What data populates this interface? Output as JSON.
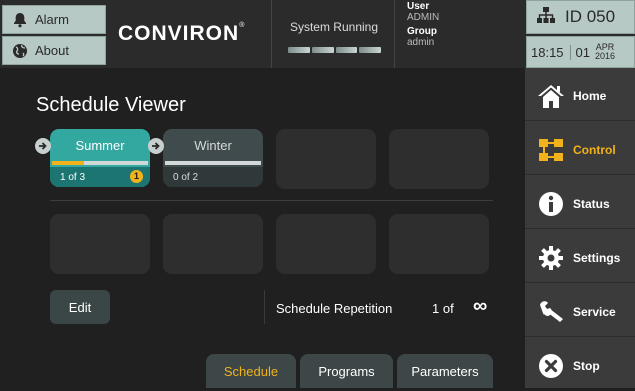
{
  "header": {
    "alarm_label": "Alarm",
    "about_label": "About",
    "logo_text": "CONVIRON",
    "logo_mark": "®",
    "system_status": "System Running",
    "user_label": "User",
    "user_value": "ADMIN",
    "group_label": "Group",
    "group_value": "admin",
    "id_text": "ID  050",
    "time": "18:15",
    "day": "01",
    "month": "APR",
    "year": "2016"
  },
  "main": {
    "title": "Schedule Viewer",
    "seasons": [
      {
        "name": "Summer",
        "progress": "1 of 3",
        "badge": "1",
        "fill_fraction": 0.33
      },
      {
        "name": "Winter",
        "progress": "0 of 2",
        "fill_fraction": 0.0
      }
    ],
    "edit_label": "Edit",
    "repetition_label": "Schedule Repetition",
    "repetition_value": "1  of",
    "repetition_infinity": "∞",
    "tabs": [
      {
        "label": "Schedule",
        "active": true
      },
      {
        "label": "Programs",
        "active": false
      },
      {
        "label": "Parameters",
        "active": false
      }
    ]
  },
  "nav": {
    "items": [
      {
        "label": "Home",
        "icon": "home-icon"
      },
      {
        "label": "Control",
        "icon": "control-icon",
        "active": true
      },
      {
        "label": "Status",
        "icon": "info-icon"
      },
      {
        "label": "Settings",
        "icon": "gear-icon"
      },
      {
        "label": "Service",
        "icon": "wrench-icon"
      },
      {
        "label": "Stop",
        "icon": "stop-icon"
      }
    ]
  },
  "colors": {
    "accent": "#f2b21b",
    "teal_active": "#33a8a0",
    "header_button": "#b7c9c4"
  }
}
